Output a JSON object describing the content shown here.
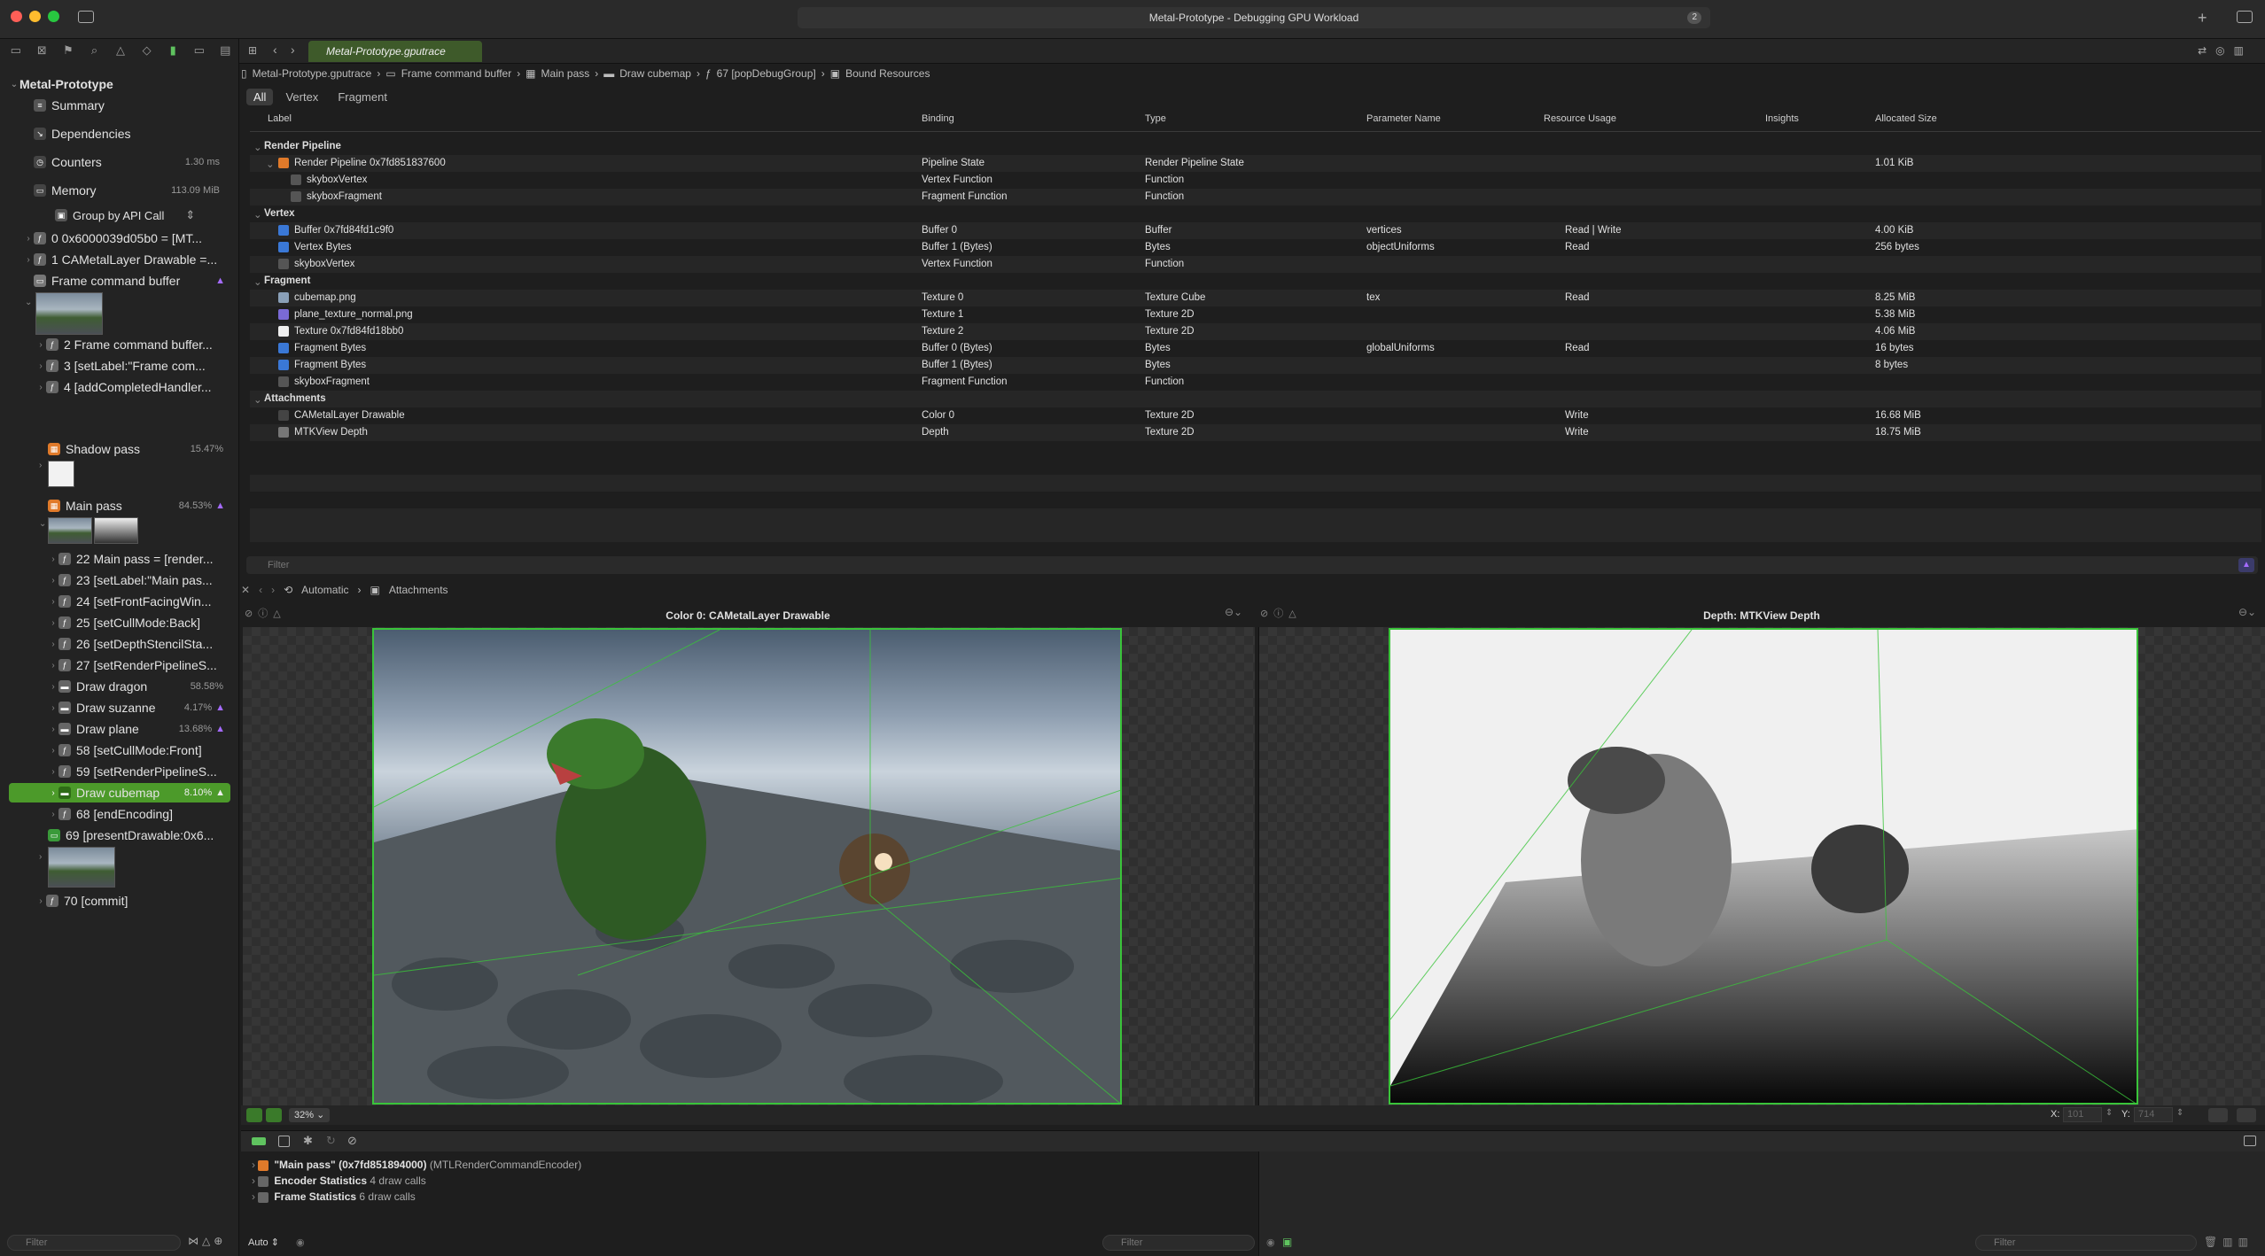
{
  "window": {
    "title": "Metal-Prototype - Debugging GPU Workload",
    "badge": "2"
  },
  "tab": {
    "label": "Metal-Prototype.gputrace"
  },
  "sidebar": {
    "project": "Metal-Prototype",
    "summary": "Summary",
    "dependencies": "Dependencies",
    "counters": {
      "label": "Counters",
      "value": "1.30 ms"
    },
    "memory": {
      "label": "Memory",
      "value": "113.09 MiB"
    },
    "group_by": "Group by API Call",
    "items": [
      {
        "label": "0 0x6000039d05b0 = [MT..."
      },
      {
        "label": "1 CAMetalLayer Drawable =..."
      },
      {
        "label": "Frame command buffer"
      },
      {
        "label": "2 Frame command buffer..."
      },
      {
        "label": "3 [setLabel:\"Frame com..."
      },
      {
        "label": "4 [addCompletedHandler..."
      },
      {
        "label": "Shadow pass",
        "value": "15.47%"
      },
      {
        "label": "Main pass",
        "value": "84.53%"
      },
      {
        "label": "22 Main pass = [render..."
      },
      {
        "label": "23 [setLabel:\"Main pas..."
      },
      {
        "label": "24 [setFrontFacingWin..."
      },
      {
        "label": "25 [setCullMode:Back]"
      },
      {
        "label": "26 [setDepthStencilSta..."
      },
      {
        "label": "27 [setRenderPipelineS..."
      },
      {
        "label": "Draw dragon",
        "value": "58.58%"
      },
      {
        "label": "Draw suzanne",
        "value": "4.17%"
      },
      {
        "label": "Draw plane",
        "value": "13.68%"
      },
      {
        "label": "58 [setCullMode:Front]"
      },
      {
        "label": "59 [setRenderPipelineS..."
      },
      {
        "label": "Draw cubemap",
        "value": "8.10%"
      },
      {
        "label": "68 [endEncoding]"
      },
      {
        "label": "69 [presentDrawable:0x6..."
      },
      {
        "label": "70 [commit]"
      }
    ],
    "filter_placeholder": "Filter"
  },
  "breadcrumb": [
    "Metal-Prototype.gputrace",
    "Frame command buffer",
    "Main pass",
    "Draw cubemap",
    "67 [popDebugGroup]",
    "Bound Resources"
  ],
  "segments": [
    "All",
    "Vertex",
    "Fragment"
  ],
  "table": {
    "headers": [
      "Label",
      "Binding",
      "Type",
      "Parameter Name",
      "Resource Usage",
      "Insights",
      "Allocated Size"
    ],
    "groups": [
      "Render Pipeline",
      "Vertex",
      "Fragment",
      "Attachments"
    ],
    "rows": [
      [
        "Render Pipeline 0x7fd851837600",
        "Pipeline State",
        "Render Pipeline State",
        "",
        "",
        "",
        "1.01 KiB"
      ],
      [
        "skyboxVertex",
        "Vertex Function",
        "Function",
        "",
        "",
        "",
        ""
      ],
      [
        "skyboxFragment",
        "Fragment Function",
        "Function",
        "",
        "",
        "",
        ""
      ],
      [
        "Buffer 0x7fd84fd1c9f0",
        "Buffer 0",
        "Buffer",
        "vertices",
        "Read | Write",
        "",
        "4.00 KiB"
      ],
      [
        "Vertex Bytes",
        "Buffer 1 (Bytes)",
        "Bytes",
        "objectUniforms",
        "Read",
        "",
        "256 bytes"
      ],
      [
        "skyboxVertex",
        "Vertex Function",
        "Function",
        "",
        "",
        "",
        ""
      ],
      [
        "cubemap.png",
        "Texture 0",
        "Texture Cube",
        "tex",
        "Read",
        "",
        "8.25 MiB"
      ],
      [
        "plane_texture_normal.png",
        "Texture 1",
        "Texture 2D",
        "",
        "",
        "",
        "5.38 MiB"
      ],
      [
        "Texture 0x7fd84fd18bb0",
        "Texture 2",
        "Texture 2D",
        "",
        "",
        "",
        "4.06 MiB"
      ],
      [
        "Fragment Bytes",
        "Buffer 0 (Bytes)",
        "Bytes",
        "globalUniforms",
        "Read",
        "",
        "16 bytes"
      ],
      [
        "Fragment Bytes",
        "Buffer 1 (Bytes)",
        "Bytes",
        "",
        "",
        "",
        "8 bytes"
      ],
      [
        "skyboxFragment",
        "Fragment Function",
        "Function",
        "",
        "",
        "",
        ""
      ],
      [
        "CAMetalLayer Drawable",
        "Color 0",
        "Texture 2D",
        "",
        "Write",
        "",
        "16.68 MiB"
      ],
      [
        "MTKView Depth",
        "Depth",
        "Texture 2D",
        "",
        "Write",
        "",
        "18.75 MiB"
      ]
    ],
    "filter_placeholder": "Filter"
  },
  "viewer": {
    "mode": "Automatic",
    "section": "Attachments",
    "left_title": "Color 0: CAMetalLayer Drawable",
    "right_title": "Depth: MTKView Depth",
    "zoom": "32%",
    "x_label": "X:",
    "x_value": "101",
    "y_label": "Y:",
    "y_value": "714"
  },
  "variables": {
    "rows": [
      {
        "name": "\"Main pass\" (0x7fd851894000)",
        "detail": "(MTLRenderCommandEncoder)"
      },
      {
        "name": "Encoder Statistics",
        "detail": "4 draw calls"
      },
      {
        "name": "Frame Statistics",
        "detail": "6 draw calls"
      }
    ],
    "scope": "Auto",
    "filter_placeholder": "Filter"
  },
  "console": {
    "filter_placeholder": "Filter"
  },
  "colors": {
    "accent_green": "#4c9a2a",
    "selection_border": "#3ac43a",
    "warning_purple": "#a56bff"
  }
}
